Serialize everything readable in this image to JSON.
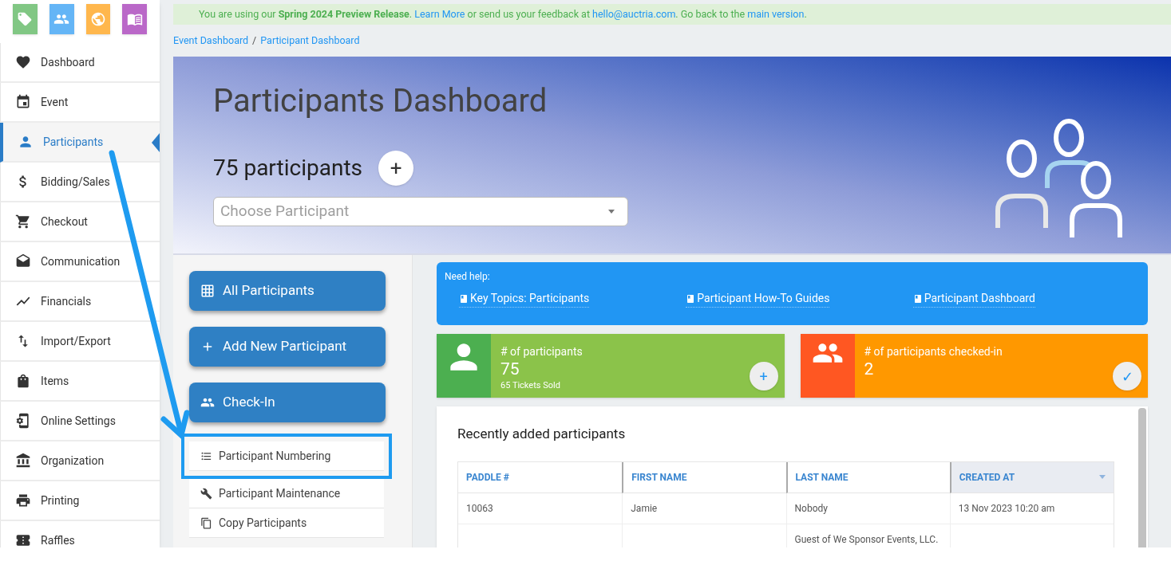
{
  "apps": [
    {
      "color": "#81c784"
    },
    {
      "color": "#64b5f6"
    },
    {
      "color": "#ffb74d"
    },
    {
      "color": "#ba68c8"
    }
  ],
  "sidebar": {
    "items": [
      {
        "label": "Dashboard",
        "selected": false
      },
      {
        "label": "Event",
        "selected": false
      },
      {
        "label": "Participants",
        "selected": true
      },
      {
        "label": "Bidding/Sales",
        "selected": false
      },
      {
        "label": "Checkout",
        "selected": false
      },
      {
        "label": "Communication",
        "selected": false
      },
      {
        "label": "Financials",
        "selected": false
      },
      {
        "label": "Import/Export",
        "selected": false
      },
      {
        "label": "Items",
        "selected": false
      },
      {
        "label": "Online Settings",
        "selected": false
      },
      {
        "label": "Organization",
        "selected": false
      },
      {
        "label": "Printing",
        "selected": false
      },
      {
        "label": "Raffles",
        "selected": false
      }
    ]
  },
  "banner": [
    {
      "kind": "text",
      "text": "You are using our "
    },
    {
      "kind": "bold",
      "text": "Spring 2024 Preview Release"
    },
    {
      "kind": "text",
      "text": ". "
    },
    {
      "kind": "link",
      "text": "Learn More"
    },
    {
      "kind": "text",
      "text": " or send us your feedback at "
    },
    {
      "kind": "link",
      "text": "hello@auctria.com"
    },
    {
      "kind": "text",
      "text": ". Go back to the "
    },
    {
      "kind": "link",
      "text": "main version"
    },
    {
      "kind": "text",
      "text": "."
    }
  ],
  "breadcrumb": [
    "Event Dashboard",
    "Participant Dashboard"
  ],
  "breadcrumb_separator": "/",
  "hero": {
    "title": "Participants Dashboard",
    "count": "75 participants",
    "add_button": "+",
    "select": {
      "placeholder": "Choose Participant"
    }
  },
  "actions": [
    "All Participants",
    "Add New Participant",
    "Check-In"
  ],
  "submenu": [
    {
      "label": "Participant Numbering",
      "highlighted": true
    },
    {
      "label": "Participant Maintenance",
      "highlighted": false
    },
    {
      "label": "Copy Participants",
      "highlighted": false
    }
  ],
  "help": {
    "title": "Need help:",
    "links": [
      "Key Topics: Participants",
      "Participant How-To Guides",
      "Participant Dashboard"
    ]
  },
  "cards": [
    {
      "kind": "count",
      "label": "# of participants",
      "value": "75",
      "note": "65 Tickets Sold",
      "button": "+"
    },
    {
      "kind": "checked-in",
      "label": "# of participants checked-in",
      "value": "2",
      "button": "✓"
    }
  ],
  "table": {
    "title": "Recently added participants",
    "columns": [
      {
        "label": "PADDLE #",
        "sorted": false
      },
      {
        "label": "FIRST NAME",
        "sorted": false
      },
      {
        "label": "LAST NAME",
        "sorted": false
      },
      {
        "label": "CREATED AT",
        "sorted": true
      }
    ],
    "rows": [
      [
        "10063",
        "Jamie",
        "Nobody",
        "13 Nov 2023 10:20 am"
      ],
      [
        "",
        "",
        "Guest of We Sponsor Events, LLC.",
        ""
      ]
    ]
  }
}
